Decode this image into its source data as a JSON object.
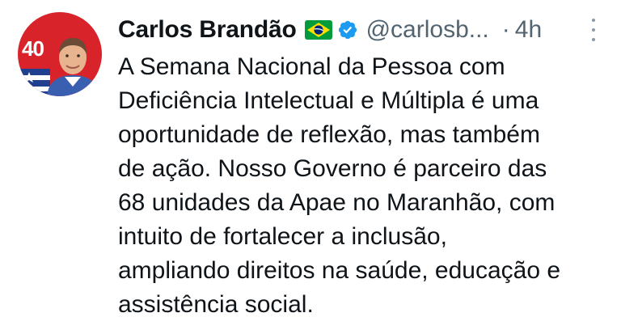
{
  "tweet": {
    "author_name": "Carlos Brandão",
    "handle": "@carlosb...",
    "separator": "·",
    "time": "4h",
    "avatar_badge": "40",
    "text_lines": [
      "A Semana Nacional da Pessoa com",
      "Deficiência Intelectual e Múltipla é uma",
      "oportunidade de reflexão, mas também",
      "de ação. Nosso Governo é parceiro das",
      "68 unidades da Apae no Maranhão, com",
      "intuito de fortalecer a inclusão,",
      "ampliando direitos na saúde, educação e",
      "assistência social."
    ]
  },
  "icons": {
    "flag": "brazil-flag-icon",
    "verified": "verified-badge-icon",
    "more": "more-options-icon"
  },
  "colors": {
    "text": "#0f1419",
    "secondary": "#536471",
    "verified_blue": "#1d9bf0",
    "avatar_red": "#d8232a",
    "flag_green": "#009c3b",
    "flag_yellow": "#ffdf00",
    "flag_blue": "#002776"
  }
}
